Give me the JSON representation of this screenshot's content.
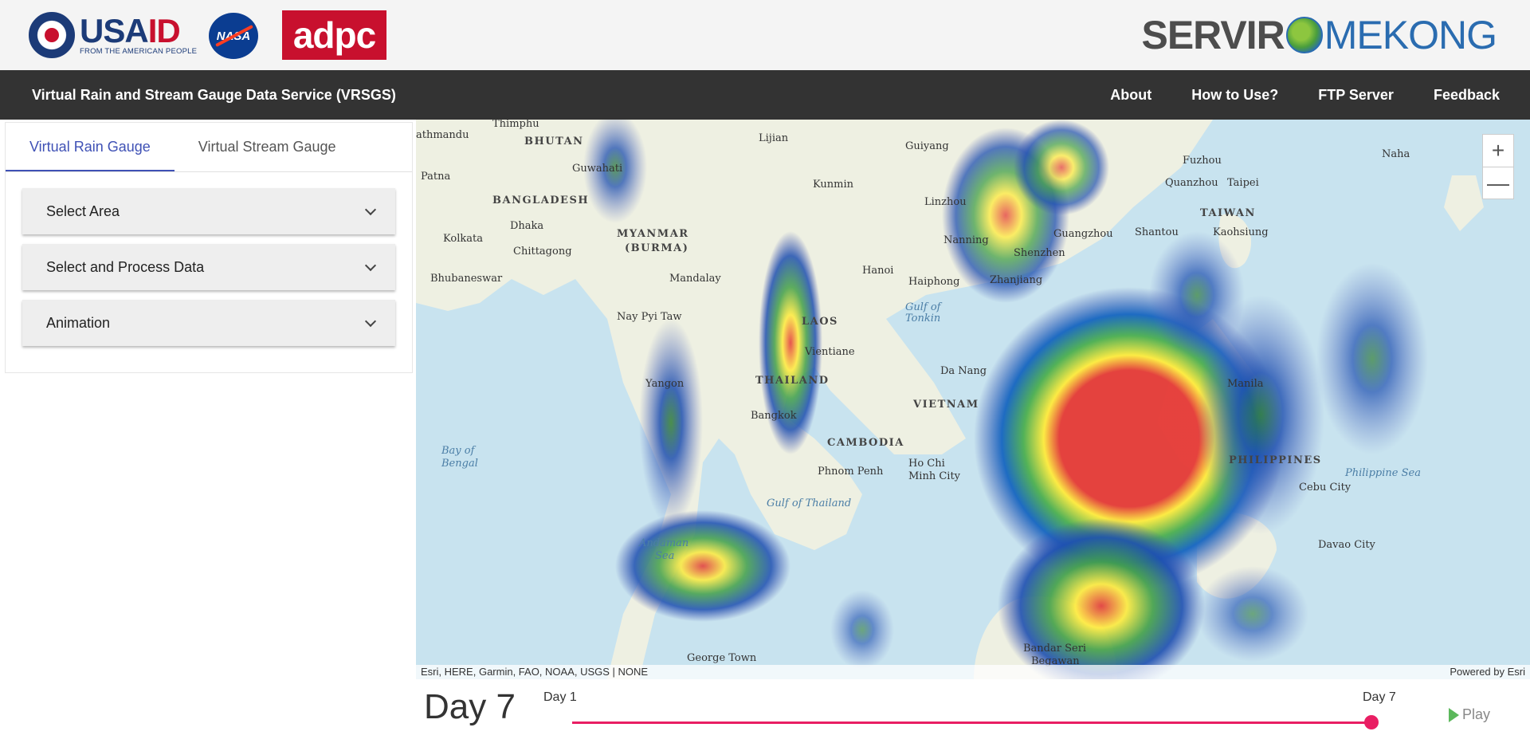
{
  "logos": {
    "usaid_word_a": "USA",
    "usaid_word_b": "ID",
    "usaid_tagline": "FROM THE AMERICAN PEOPLE",
    "nasa": "NASA",
    "adpc": "adpc",
    "servir_a": "SERVIR",
    "servir_b": "MEKONG"
  },
  "navbar": {
    "title": "Virtual Rain and Stream Gauge Data Service (VRSGS)",
    "links": [
      "About",
      "How to Use?",
      "FTP Server",
      "Feedback"
    ]
  },
  "sidebar": {
    "tabs": [
      "Virtual Rain Gauge",
      "Virtual Stream Gauge"
    ],
    "active_tab": "Virtual Rain Gauge",
    "sections": [
      "Select Area",
      "Select and Process Data",
      "Animation"
    ]
  },
  "map": {
    "zoom_in": "+",
    "zoom_out": "—",
    "attribution": "Esri, HERE, Garmin, FAO, NOAA, USGS | NONE",
    "powered_by": "Powered by Esri",
    "labels": {
      "thimphu": "Thimphu",
      "kathmandu": "athmandu",
      "bhutan": "BHUTAN",
      "guwahati": "Guwahati",
      "patna": "Patna",
      "bangladesh": "BANGLADESH",
      "dhaka": "Dhaka",
      "kolkata": "Kolkata",
      "chittagong": "Chittagong",
      "bhubaneswar": "Bhubaneswar",
      "myanmar": "MYANMAR",
      "burma": "(BURMA)",
      "mandalay": "Mandalay",
      "naypyitaw": "Nay Pyi Taw",
      "yangon": "Yangon",
      "bay_of_bengal_1": "Bay of",
      "bay_of_bengal_2": "Bengal",
      "andaman_1": "Andaman",
      "andaman_2": "Sea",
      "lijiang": "Lijian",
      "kunming": "Kunmin",
      "guiyang": "Guiyang",
      "linzhou": "Linzhou",
      "nanning": "Nanning",
      "hanoi": "Hanoi",
      "haiphong": "Haiphong",
      "gulf_tonkin_1": "Gulf of",
      "gulf_tonkin_2": "Tonkin",
      "laos": "LAOS",
      "vientiane": "Vientiane",
      "thailand": "THAILAND",
      "bangkok": "Bangkok",
      "cambodia": "CAMBODIA",
      "phnom_penh": "Phnom Penh",
      "ho_chi_minh_1": "Ho Chi",
      "ho_chi_minh_2": "Minh City",
      "vietnam": "VIETNAM",
      "da_nang": "Da Nang",
      "gulf_thailand": "Gulf of Thailand",
      "george_town": "George Town",
      "shenzhen": "Shenzhen",
      "zhanjiang": "Zhanjiang",
      "guangzhou": "Guangzhou",
      "shantou": "Shantou",
      "fuzhou": "Fuzhou",
      "quanzhou": "Quanzhou",
      "taipei": "Taipei",
      "taiwan": "TAIWAN",
      "kaohsiung": "Kaohsiung",
      "naha": "Naha",
      "manila": "Manila",
      "philippines": "PHILIPPINES",
      "philippine_sea": "Philippine Sea",
      "cebu": "Cebu City",
      "davao": "Davao City",
      "bandar_1": "Bandar Seri",
      "bandar_2": "Begawan"
    }
  },
  "animation": {
    "current_day": "Day 7",
    "start_label": "Day 1",
    "end_label": "Day 7",
    "position": 1.0,
    "play_label": "Play"
  },
  "colors": {
    "accent": "#3f51b5",
    "slider": "#e91e63",
    "navbar": "#333333",
    "play_icon": "#5cb85c"
  }
}
